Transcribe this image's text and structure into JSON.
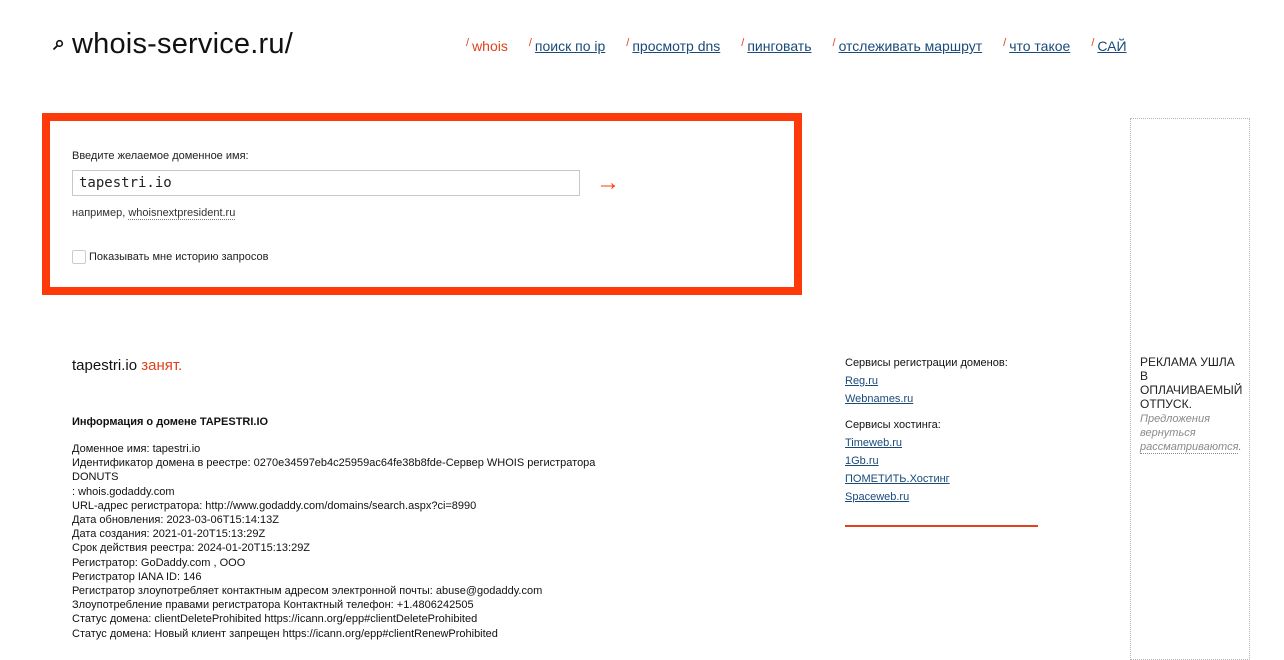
{
  "header": {
    "logo": "whois-service.ru/",
    "nav": [
      {
        "label": "whois",
        "active": true
      },
      {
        "label": "поиск по ip"
      },
      {
        "label": "просмотр dns"
      },
      {
        "label": "пинговать"
      },
      {
        "label": "отслеживать маршрут"
      },
      {
        "label": "что такое"
      },
      {
        "label": "САЙ"
      }
    ]
  },
  "search": {
    "label": "Введите желаемое доменное имя:",
    "value": "tapestri.io",
    "example_prefix": "например,",
    "example_link": "whoisnextpresident.ru",
    "history_label": "Показывать мне историю запросов",
    "submit_glyph": "→"
  },
  "result": {
    "domain": "tapestri.io",
    "status": "занят."
  },
  "info": {
    "title": "Информация о домене TAPESTRI.IO",
    "lines": [
      "Доменное имя: tapestri.io",
      "Идентификатор домена в реестре: 0270e34597eb4c25959ac64fe38b8fde-Сервер WHOIS регистратора",
      "DONUTS",
      ": whois.godaddy.com",
      "URL-адрес регистратора: http://www.godaddy.com/domains/search.aspx?ci=8990",
      "Дата обновления: 2023-03-06T15:14:13Z",
      "Дата создания: 2021-01-20T15:13:29Z",
      "Срок действия реестра: 2024-01-20T15:13:29Z",
      "Регистратор: GoDaddy.com , ООО",
      "Регистратор IANA ID: 146",
      "Регистратор злоупотребляет контактным адресом электронной почты: abuse@godaddy.com",
      "Злоупотребление правами регистратора Контактный телефон: +1.4806242505",
      "Статус домена: clientDeleteProhibited https://icann.org/epp#clientDeleteProhibited",
      "Статус домена: Новый клиент запрещен https://icann.org/epp#clientRenewProhibited"
    ]
  },
  "sidebar": {
    "registration_heading": "Сервисы регистрации доменов:",
    "registration_links": [
      "Reg.ru",
      "Webnames.ru"
    ],
    "hosting_heading": "Сервисы хостинга:",
    "hosting_links": [
      "Timeweb.ru",
      "1Gb.ru",
      "ПОМЕТИТЬ.Хостинг",
      "Spaceweb.ru"
    ]
  },
  "ad": {
    "title": "РЕКЛАМА УШЛА В ОПЛАЧИВАЕМЫЙ ОТПУСК.",
    "note_prefix": "Предложения вернуться",
    "note_link": "рассматриваются",
    "note_suffix": "."
  },
  "colors": {
    "accent": "#e0421b",
    "search_border": "#ff3a0a",
    "link": "#1a4a7a"
  }
}
